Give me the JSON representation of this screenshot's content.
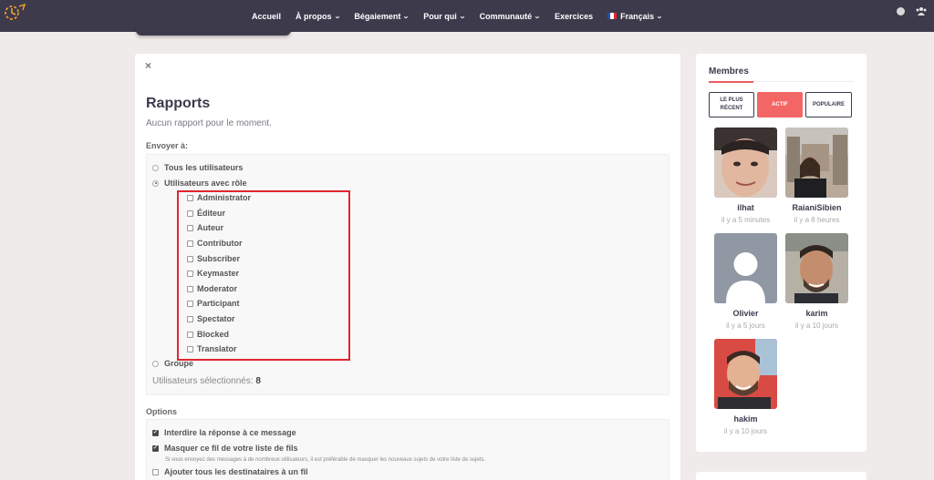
{
  "nav": {
    "items": [
      {
        "label": "Accueil",
        "dropdown": false
      },
      {
        "label": "À propos",
        "dropdown": true
      },
      {
        "label": "Bégaiement",
        "dropdown": true
      },
      {
        "label": "Pour qui",
        "dropdown": true
      },
      {
        "label": "Communauté",
        "dropdown": true
      },
      {
        "label": "Exercices",
        "dropdown": false
      }
    ],
    "language": "Français"
  },
  "colors": {
    "topbar": "#3d3a4c",
    "accent": "#f36666",
    "highlight_border": "#e0262f"
  },
  "rapports": {
    "close_label": "×",
    "title": "Rapports",
    "subtitle": "Aucun rapport pour le moment.",
    "send_to_label": "Envoyer à:",
    "radio_all": "Tous les utilisateurs",
    "radio_role": "Utilisateurs avec rôle",
    "radio_group": "Groupe",
    "roles": [
      "Administrator",
      "Éditeur",
      "Auteur",
      "Contributor",
      "Subscriber",
      "Keymaster",
      "Moderator",
      "Participant",
      "Spectator",
      "Blocked",
      "Translator"
    ],
    "selected_label": "Utilisateurs sélectionnés:",
    "selected_count": "8",
    "options_label": "Options",
    "opt_no_reply": "Interdire la réponse à ce message",
    "opt_hide": "Masquer ce fil de votre liste de fils",
    "opt_hide_note": "Si vous envoyez des messages à de nombreux utilisateurs, il est préférable de masquer les nouveaux sujets de votre liste de sujets.",
    "opt_add_all": "Ajouter tous les destinataires à un fil"
  },
  "sidebar": {
    "title": "Membres",
    "tabs": [
      "LE PLUS RÉCENT",
      "ACTIF",
      "POPULAIRE"
    ],
    "members": [
      {
        "name": "ilhat",
        "time": "il y a 5 minutes"
      },
      {
        "name": "RaianiSibien",
        "time": "il y a 8 heures"
      },
      {
        "name": "Olivier",
        "time": "il y a 5 jours"
      },
      {
        "name": "karim",
        "time": "il y a 10 jours"
      },
      {
        "name": "hakim",
        "time": "il y a 10 jours"
      }
    ]
  }
}
